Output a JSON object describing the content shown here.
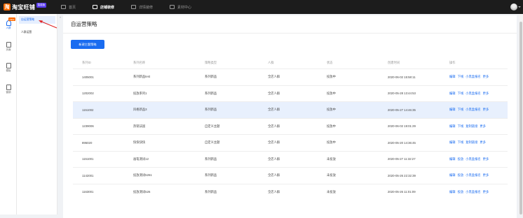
{
  "app": {
    "logo_text": "淘宝旺铺",
    "logo_badge": "智能版"
  },
  "topnav": [
    {
      "label": "首页",
      "active": false
    },
    {
      "label": "店铺装修",
      "active": true
    },
    {
      "label": "详情装修",
      "active": false
    },
    {
      "label": "素材中心",
      "active": false
    }
  ],
  "rail": [
    {
      "label": "人群",
      "icon": "user-icon",
      "active": true,
      "badge": "NEW"
    },
    {
      "label": "页面",
      "icon": "page-icon",
      "active": false
    },
    {
      "label": "模板",
      "icon": "template-icon",
      "active": false
    },
    {
      "label": "营销",
      "icon": "bag-icon",
      "active": false
    }
  ],
  "subnav": [
    {
      "label": "自运营策略",
      "active": true
    },
    {
      "label": "人群运营",
      "active": false
    }
  ],
  "page": {
    "title": "自运营策略",
    "new_button": "新建主题策略"
  },
  "table": {
    "headers": [
      "系列ID",
      "系列名称",
      "策略类型",
      "人群",
      "状态",
      "创建时间",
      "操作"
    ],
    "rows": [
      {
        "id": "1405001",
        "name": "系列新品test",
        "type": "系列新品",
        "crowd": "全店人群",
        "status": "投放中",
        "time": "2020-06-02 15:58:11",
        "actions": [
          "编辑",
          "下线",
          "小黑盒报名",
          "更多"
        ],
        "highlight": false
      },
      {
        "id": "1202002",
        "name": "投放系列1",
        "type": "系列新品",
        "crowd": "全店人群",
        "status": "投放中",
        "time": "2020-05-28 13:44:53",
        "actions": [
          "编辑",
          "下线",
          "小黑盒报名",
          "更多"
        ],
        "highlight": false
      },
      {
        "id": "1151002",
        "name": "风格新品3",
        "type": "系列新品",
        "crowd": "全店人群",
        "status": "投放中",
        "time": "2020-05-27 14:46:35",
        "actions": [
          "编辑",
          "下线",
          "小黑盒报名",
          "更多"
        ],
        "highlight": true
      },
      {
        "id": "1239006",
        "name": "热销法国",
        "type": "自定义主题",
        "crowd": "全店人群",
        "status": "投放中",
        "time": "2020-06-02 19:01:29",
        "actions": [
          "编辑",
          "下线",
          "复制链接",
          "更多"
        ],
        "highlight": false
      },
      {
        "id": "895020",
        "name": "快快快快",
        "type": "自定义主题",
        "crowd": "全店人群",
        "status": "投放中",
        "time": "2020-05-20 14:36:45",
        "actions": [
          "编辑",
          "下线",
          "复制链接",
          "更多"
        ],
        "highlight": false
      },
      {
        "id": "1151001",
        "name": "画笔测试12",
        "type": "系列新品",
        "crowd": "全店人群",
        "status": "未投放",
        "time": "2020-05-27 11:32:27",
        "actions": [
          "编辑",
          "投放",
          "小黑盒报名",
          "更多"
        ],
        "highlight": false
      },
      {
        "id": "1142001",
        "name": "投放测试5261",
        "type": "系列新品",
        "crowd": "全店人群",
        "status": "未投放",
        "time": "2020-05-26 22:32:39",
        "actions": [
          "编辑",
          "投放",
          "小黑盒报名",
          "更多"
        ],
        "highlight": false
      },
      {
        "id": "1163001",
        "name": "投放测试526",
        "type": "系列新品",
        "crowd": "全店人群",
        "status": "未投放",
        "time": "2020-05-26 11:01:09",
        "actions": [
          "编辑",
          "投放",
          "小黑盒报名",
          "更多"
        ],
        "highlight": false
      }
    ]
  },
  "colors": {
    "accent": "#1a6cf0",
    "topbar": "#1c1c1c",
    "highlight_row": "#e8f0fd",
    "annotation": "#e02020"
  }
}
